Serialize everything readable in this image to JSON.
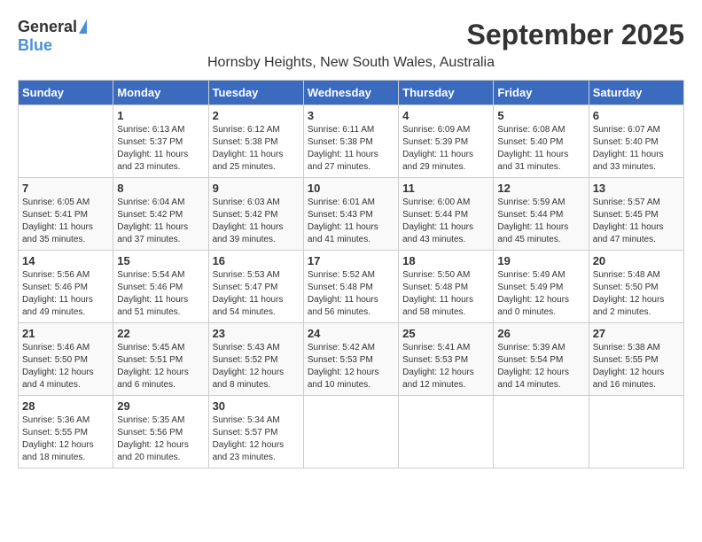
{
  "header": {
    "logo_general": "General",
    "logo_blue": "Blue",
    "month_title": "September 2025",
    "location": "Hornsby Heights, New South Wales, Australia"
  },
  "days_of_week": [
    "Sunday",
    "Monday",
    "Tuesday",
    "Wednesday",
    "Thursday",
    "Friday",
    "Saturday"
  ],
  "weeks": [
    [
      {
        "day": "",
        "sunrise": "",
        "sunset": "",
        "daylight": ""
      },
      {
        "day": "1",
        "sunrise": "Sunrise: 6:13 AM",
        "sunset": "Sunset: 5:37 PM",
        "daylight": "Daylight: 11 hours and 23 minutes."
      },
      {
        "day": "2",
        "sunrise": "Sunrise: 6:12 AM",
        "sunset": "Sunset: 5:38 PM",
        "daylight": "Daylight: 11 hours and 25 minutes."
      },
      {
        "day": "3",
        "sunrise": "Sunrise: 6:11 AM",
        "sunset": "Sunset: 5:38 PM",
        "daylight": "Daylight: 11 hours and 27 minutes."
      },
      {
        "day": "4",
        "sunrise": "Sunrise: 6:09 AM",
        "sunset": "Sunset: 5:39 PM",
        "daylight": "Daylight: 11 hours and 29 minutes."
      },
      {
        "day": "5",
        "sunrise": "Sunrise: 6:08 AM",
        "sunset": "Sunset: 5:40 PM",
        "daylight": "Daylight: 11 hours and 31 minutes."
      },
      {
        "day": "6",
        "sunrise": "Sunrise: 6:07 AM",
        "sunset": "Sunset: 5:40 PM",
        "daylight": "Daylight: 11 hours and 33 minutes."
      }
    ],
    [
      {
        "day": "7",
        "sunrise": "Sunrise: 6:05 AM",
        "sunset": "Sunset: 5:41 PM",
        "daylight": "Daylight: 11 hours and 35 minutes."
      },
      {
        "day": "8",
        "sunrise": "Sunrise: 6:04 AM",
        "sunset": "Sunset: 5:42 PM",
        "daylight": "Daylight: 11 hours and 37 minutes."
      },
      {
        "day": "9",
        "sunrise": "Sunrise: 6:03 AM",
        "sunset": "Sunset: 5:42 PM",
        "daylight": "Daylight: 11 hours and 39 minutes."
      },
      {
        "day": "10",
        "sunrise": "Sunrise: 6:01 AM",
        "sunset": "Sunset: 5:43 PM",
        "daylight": "Daylight: 11 hours and 41 minutes."
      },
      {
        "day": "11",
        "sunrise": "Sunrise: 6:00 AM",
        "sunset": "Sunset: 5:44 PM",
        "daylight": "Daylight: 11 hours and 43 minutes."
      },
      {
        "day": "12",
        "sunrise": "Sunrise: 5:59 AM",
        "sunset": "Sunset: 5:44 PM",
        "daylight": "Daylight: 11 hours and 45 minutes."
      },
      {
        "day": "13",
        "sunrise": "Sunrise: 5:57 AM",
        "sunset": "Sunset: 5:45 PM",
        "daylight": "Daylight: 11 hours and 47 minutes."
      }
    ],
    [
      {
        "day": "14",
        "sunrise": "Sunrise: 5:56 AM",
        "sunset": "Sunset: 5:46 PM",
        "daylight": "Daylight: 11 hours and 49 minutes."
      },
      {
        "day": "15",
        "sunrise": "Sunrise: 5:54 AM",
        "sunset": "Sunset: 5:46 PM",
        "daylight": "Daylight: 11 hours and 51 minutes."
      },
      {
        "day": "16",
        "sunrise": "Sunrise: 5:53 AM",
        "sunset": "Sunset: 5:47 PM",
        "daylight": "Daylight: 11 hours and 54 minutes."
      },
      {
        "day": "17",
        "sunrise": "Sunrise: 5:52 AM",
        "sunset": "Sunset: 5:48 PM",
        "daylight": "Daylight: 11 hours and 56 minutes."
      },
      {
        "day": "18",
        "sunrise": "Sunrise: 5:50 AM",
        "sunset": "Sunset: 5:48 PM",
        "daylight": "Daylight: 11 hours and 58 minutes."
      },
      {
        "day": "19",
        "sunrise": "Sunrise: 5:49 AM",
        "sunset": "Sunset: 5:49 PM",
        "daylight": "Daylight: 12 hours and 0 minutes."
      },
      {
        "day": "20",
        "sunrise": "Sunrise: 5:48 AM",
        "sunset": "Sunset: 5:50 PM",
        "daylight": "Daylight: 12 hours and 2 minutes."
      }
    ],
    [
      {
        "day": "21",
        "sunrise": "Sunrise: 5:46 AM",
        "sunset": "Sunset: 5:50 PM",
        "daylight": "Daylight: 12 hours and 4 minutes."
      },
      {
        "day": "22",
        "sunrise": "Sunrise: 5:45 AM",
        "sunset": "Sunset: 5:51 PM",
        "daylight": "Daylight: 12 hours and 6 minutes."
      },
      {
        "day": "23",
        "sunrise": "Sunrise: 5:43 AM",
        "sunset": "Sunset: 5:52 PM",
        "daylight": "Daylight: 12 hours and 8 minutes."
      },
      {
        "day": "24",
        "sunrise": "Sunrise: 5:42 AM",
        "sunset": "Sunset: 5:53 PM",
        "daylight": "Daylight: 12 hours and 10 minutes."
      },
      {
        "day": "25",
        "sunrise": "Sunrise: 5:41 AM",
        "sunset": "Sunset: 5:53 PM",
        "daylight": "Daylight: 12 hours and 12 minutes."
      },
      {
        "day": "26",
        "sunrise": "Sunrise: 5:39 AM",
        "sunset": "Sunset: 5:54 PM",
        "daylight": "Daylight: 12 hours and 14 minutes."
      },
      {
        "day": "27",
        "sunrise": "Sunrise: 5:38 AM",
        "sunset": "Sunset: 5:55 PM",
        "daylight": "Daylight: 12 hours and 16 minutes."
      }
    ],
    [
      {
        "day": "28",
        "sunrise": "Sunrise: 5:36 AM",
        "sunset": "Sunset: 5:55 PM",
        "daylight": "Daylight: 12 hours and 18 minutes."
      },
      {
        "day": "29",
        "sunrise": "Sunrise: 5:35 AM",
        "sunset": "Sunset: 5:56 PM",
        "daylight": "Daylight: 12 hours and 20 minutes."
      },
      {
        "day": "30",
        "sunrise": "Sunrise: 5:34 AM",
        "sunset": "Sunset: 5:57 PM",
        "daylight": "Daylight: 12 hours and 23 minutes."
      },
      {
        "day": "",
        "sunrise": "",
        "sunset": "",
        "daylight": ""
      },
      {
        "day": "",
        "sunrise": "",
        "sunset": "",
        "daylight": ""
      },
      {
        "day": "",
        "sunrise": "",
        "sunset": "",
        "daylight": ""
      },
      {
        "day": "",
        "sunrise": "",
        "sunset": "",
        "daylight": ""
      }
    ]
  ]
}
